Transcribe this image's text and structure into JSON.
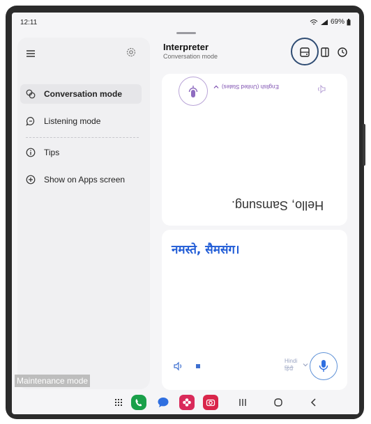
{
  "status": {
    "time": "12:11",
    "battery": "69%"
  },
  "sidebar": {
    "items": [
      {
        "label": "Conversation mode",
        "icon": "chat-bubbles-icon",
        "active": true
      },
      {
        "label": "Listening mode",
        "icon": "listening-bubble-icon",
        "active": false
      },
      {
        "label": "Tips",
        "icon": "info-icon",
        "active": false
      },
      {
        "label": "Show on Apps screen",
        "icon": "plus-circle-icon",
        "active": false
      }
    ]
  },
  "header": {
    "title": "Interpreter",
    "subtitle": "Conversation mode"
  },
  "top_panel": {
    "language": "English (United States)",
    "text": "Hello, Samsung."
  },
  "bottom_panel": {
    "language_en": "Hindi",
    "language_native": "हिंदी",
    "text": "नमस्ते, सैमसंग।"
  },
  "maintenance_label": "Maintenance mode",
  "colors": {
    "accent_blue": "#1f5bd6",
    "accent_purple": "#7d4fb0",
    "highlight_ring": "#2f4c73"
  }
}
